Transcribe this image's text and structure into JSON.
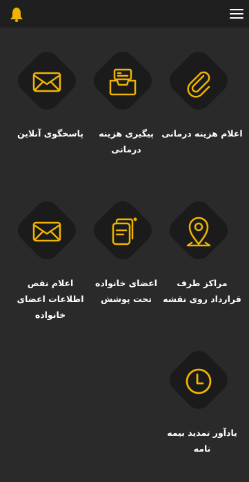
{
  "app": {
    "logo_icon": "bell-icon",
    "menu_icon": "hamburger-icon",
    "accent_color": "#f0b400",
    "background_color": "#2a2a2a",
    "tile_color": "#1b1b1b"
  },
  "tiles": [
    {
      "label": "اعلام هزینه درمانی",
      "icon": "paperclip-icon"
    },
    {
      "label": "پیگیری هزینه درمانی",
      "icon": "inbox-tray-icon"
    },
    {
      "label": "پاسخگوی آنلاین",
      "icon": "mail-icon"
    },
    {
      "label": "مراکز طرف قرارداد روی نقشه",
      "icon": "map-pin-icon"
    },
    {
      "label": "اعضای خانواده تحت پوشش",
      "icon": "document-stack-icon"
    },
    {
      "label": "اعلام نقص اطلاعات اعضای خانواده",
      "icon": "mail-icon"
    },
    {
      "label": "یادآور تمدید بیمه نامه",
      "icon": "clock-icon"
    }
  ]
}
